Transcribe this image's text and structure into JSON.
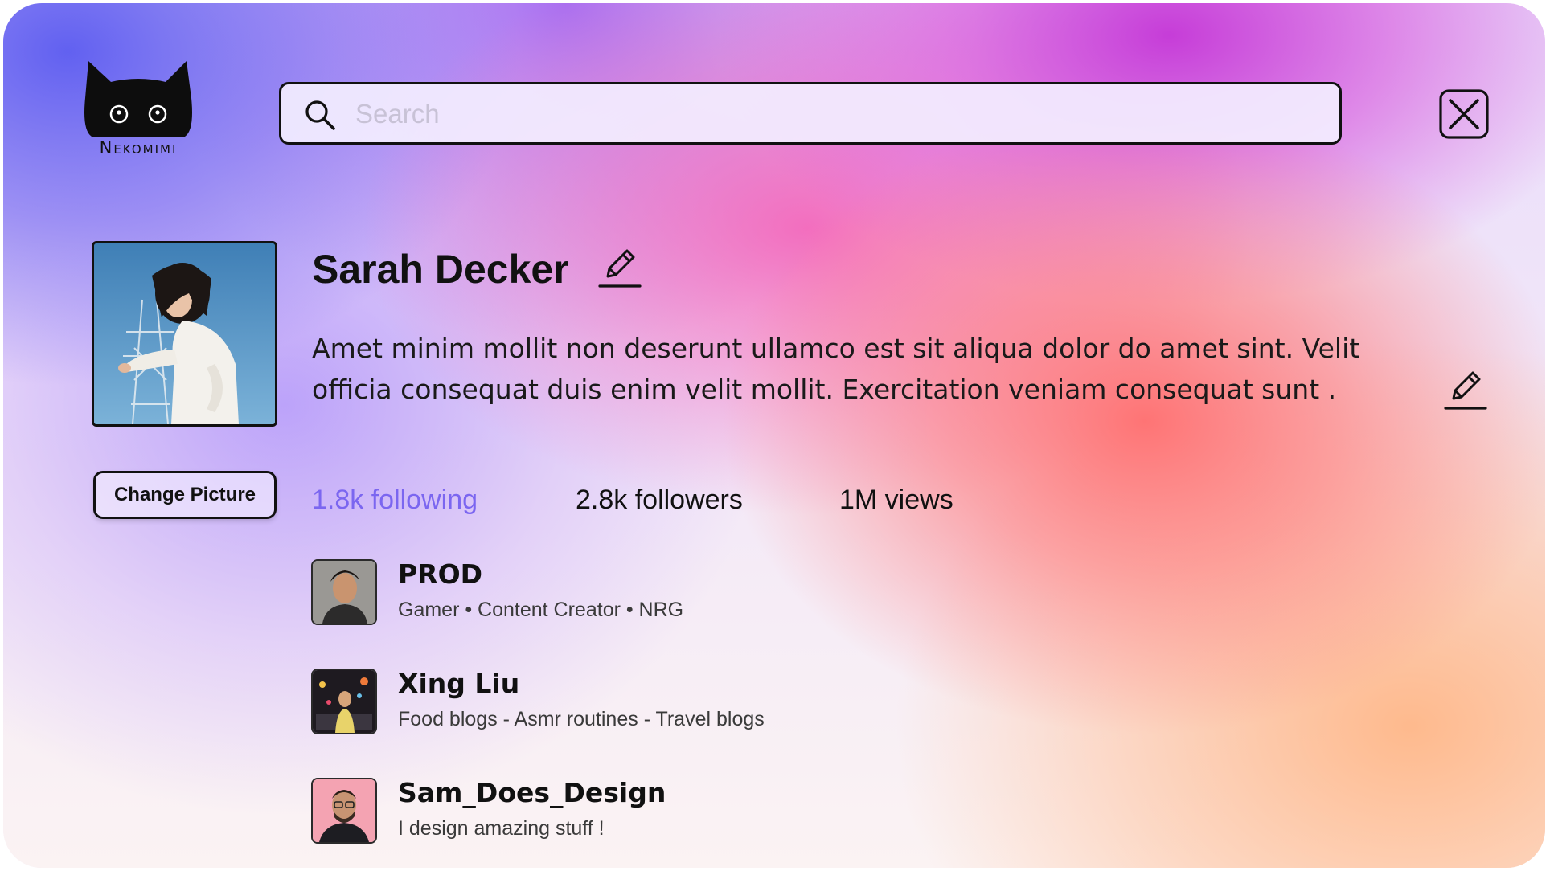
{
  "brand": {
    "name": "Nekomimi"
  },
  "search": {
    "placeholder": "Search",
    "value": ""
  },
  "profile": {
    "name": "Sarah Decker",
    "bio": "Amet minim mollit non deserunt ullamco est sit aliqua dolor do amet sint. Velit officia consequat duis enim velit mollit. Exercitation veniam  consequat sunt .",
    "change_picture_label": "Change Picture"
  },
  "stats": {
    "following": "1.8k following",
    "followers": "2.8k followers",
    "views": "1M views"
  },
  "list": [
    {
      "title": "PROD",
      "subtitle": "Gamer • Content Creator • NRG"
    },
    {
      "title": "Xing Liu",
      "subtitle": "Food blogs - Asmr routines - Travel blogs"
    },
    {
      "title": "Sam_Does_Design",
      "subtitle": "I design amazing stuff !"
    }
  ],
  "colors": {
    "accent_following": "#7b66f0",
    "text": "#111111"
  },
  "icons": {
    "logo": "cat-ears-icon",
    "search": "search-icon",
    "close": "close-icon",
    "edit": "pencil-icon"
  }
}
